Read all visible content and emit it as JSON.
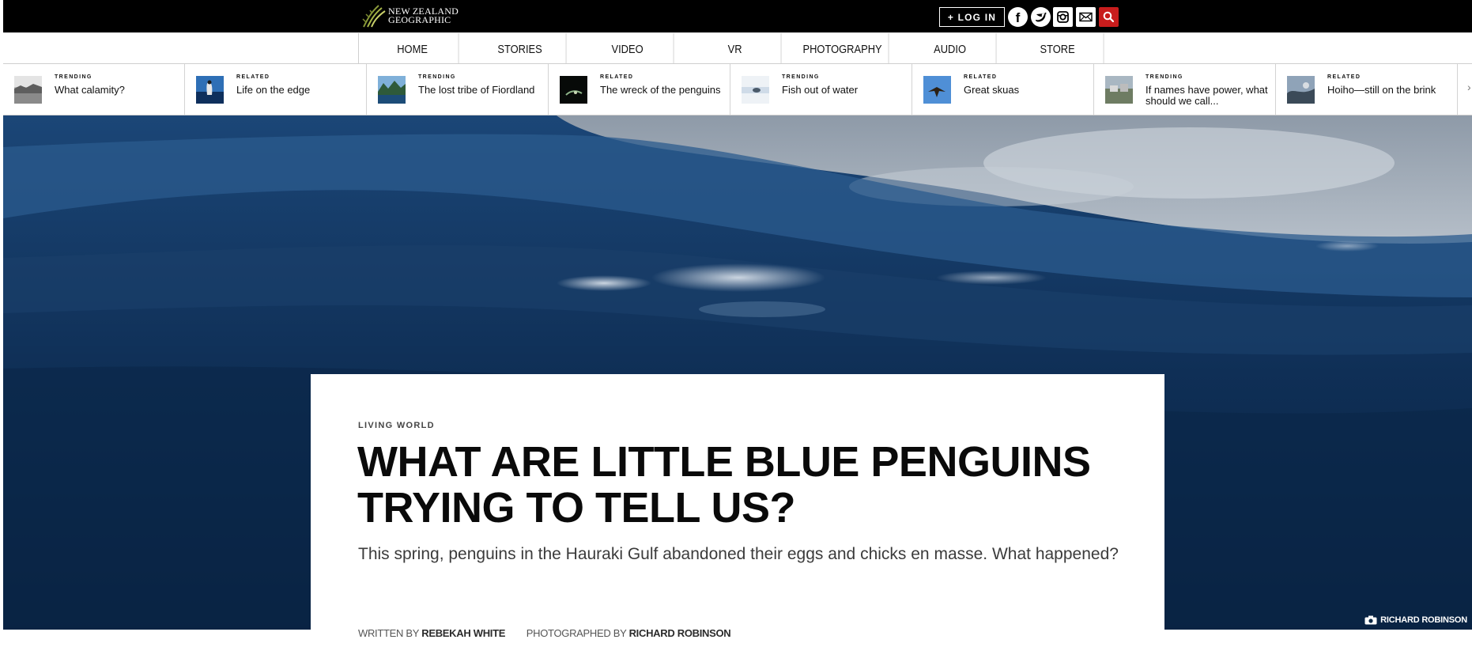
{
  "header": {
    "logo_line1": "NEW ZEALAND",
    "logo_line2": "GEOGRAPHIC",
    "login_label": "+ LOG IN",
    "social_icons": [
      "facebook-icon",
      "twitter-icon",
      "instagram-icon",
      "mail-icon",
      "search-icon"
    ]
  },
  "nav": {
    "items": [
      {
        "label": "HOME"
      },
      {
        "label": "STORIES"
      },
      {
        "label": "VIDEO"
      },
      {
        "label": "VR"
      },
      {
        "label": "PHOTOGRAPHY"
      },
      {
        "label": "AUDIO"
      },
      {
        "label": "STORE"
      }
    ]
  },
  "strip": {
    "items": [
      {
        "tag": "TRENDING",
        "title": "What calamity?"
      },
      {
        "tag": "RELATED",
        "title": "Life on the edge"
      },
      {
        "tag": "TRENDING",
        "title": "The lost tribe of Fiordland"
      },
      {
        "tag": "RELATED",
        "title": "The wreck of the penguins"
      },
      {
        "tag": "TRENDING",
        "title": "Fish out of water"
      },
      {
        "tag": "RELATED",
        "title": "Great skuas"
      },
      {
        "tag": "TRENDING",
        "title": "If names have power, what should we call..."
      },
      {
        "tag": "RELATED",
        "title": "Hoiho—still on the brink"
      }
    ],
    "more_arrow": "›"
  },
  "hero": {
    "credit": "RICHARD ROBINSON"
  },
  "article": {
    "category": "LIVING WORLD",
    "title": "WHAT ARE LITTLE BLUE PENGUINS TRYING TO TELL US?",
    "standfirst": "This spring, penguins in the Hauraki Gulf abandoned their eggs and chicks en masse. What happened?",
    "written_by_label": "WRITTEN BY",
    "author": "REBEKAH WHITE",
    "photographed_by_label": "PHOTOGRAPHED BY",
    "photographer": "RICHARD ROBINSON"
  },
  "colors": {
    "topbar": "#000000",
    "search_button": "#c81d1d",
    "hero_water": "#0c2846"
  }
}
